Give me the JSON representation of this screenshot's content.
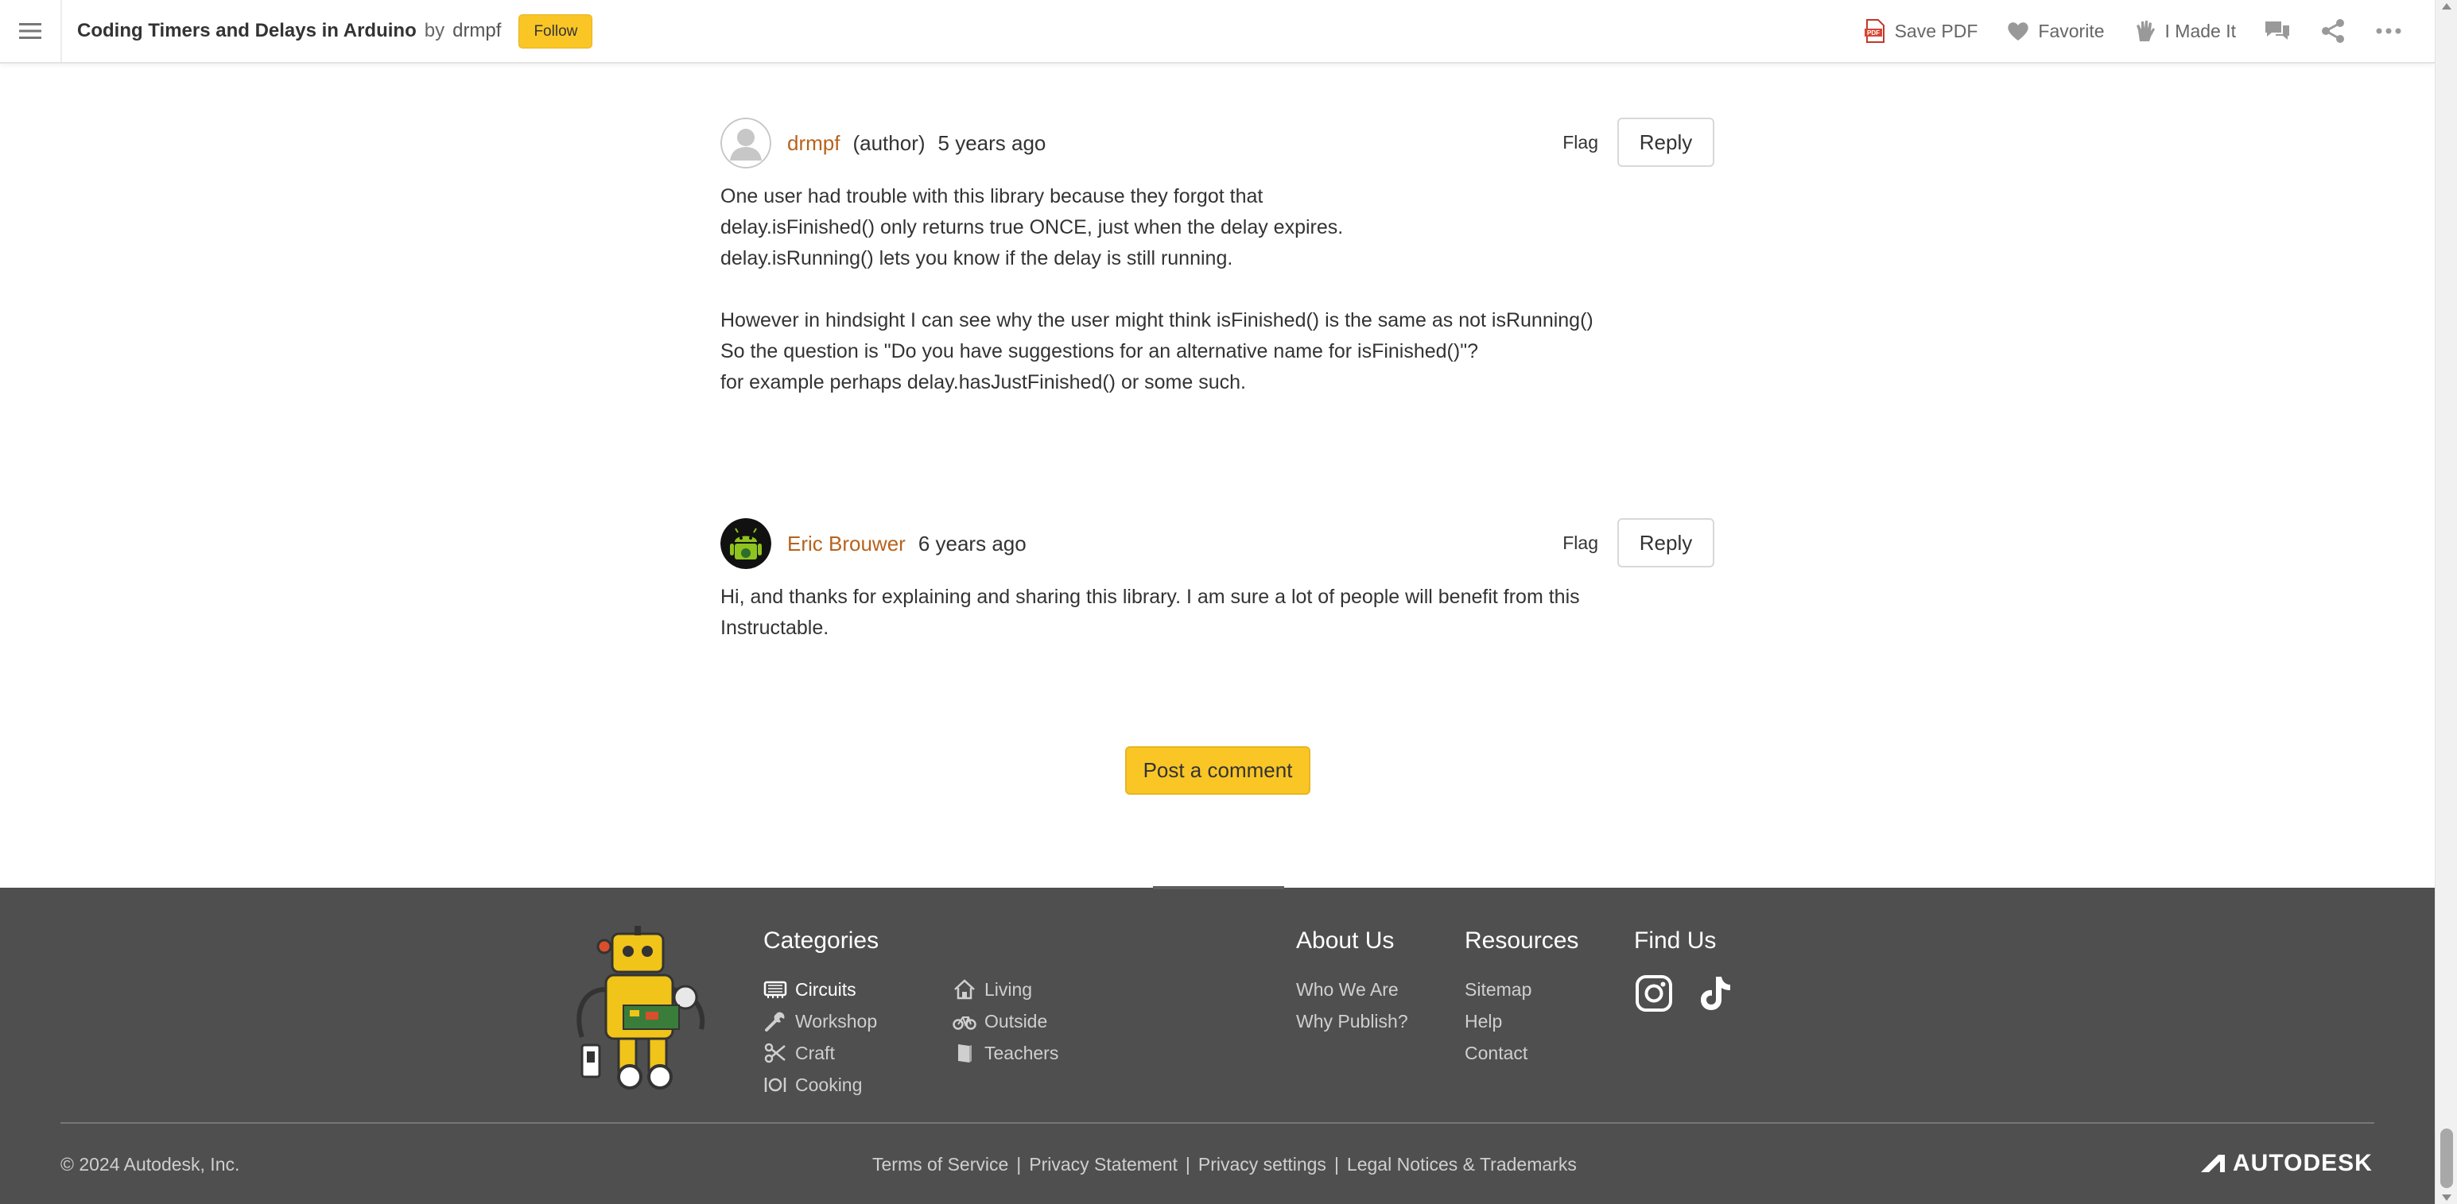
{
  "header": {
    "title": "Coding Timers and Delays in Arduino",
    "by_label": "by",
    "author": "drmpf",
    "follow_label": "Follow",
    "actions": {
      "save_pdf": "Save PDF",
      "favorite": "Favorite",
      "made_it": "I Made It"
    }
  },
  "comments": [
    {
      "author": "drmpf",
      "role": "(author)",
      "time": "5 years ago",
      "flag": "Flag",
      "reply": "Reply",
      "lines": [
        "One user had trouble with this library because they forgot that",
        "delay.isFinished() only returns true ONCE, just when the delay expires.",
        "delay.isRunning() lets you know if the delay is still running.",
        "",
        "However in hindsight I can see why the user might think isFinished() is the same as not isRunning()",
        "So the question is \"Do you have suggestions for an alternative name for isFinished()\"?",
        "for example perhaps delay.hasJustFinished() or some such."
      ]
    },
    {
      "author": "Eric Brouwer",
      "time": "6 years ago",
      "flag": "Flag",
      "reply": "Reply",
      "text": "Hi, and thanks for explaining and sharing this library. I am sure a lot of people will benefit from this Instructable."
    }
  ],
  "post_comment_label": "Post a comment",
  "footer": {
    "categories_heading": "Categories",
    "categories_col1": [
      "Circuits",
      "Workshop",
      "Craft",
      "Cooking"
    ],
    "categories_col2": [
      "Living",
      "Outside",
      "Teachers"
    ],
    "about_heading": "About Us",
    "about_links": [
      "Who We Are",
      "Why Publish?"
    ],
    "resources_heading": "Resources",
    "resources_links": [
      "Sitemap",
      "Help",
      "Contact"
    ],
    "find_heading": "Find Us",
    "copyright": "© 2024 Autodesk, Inc.",
    "legal_links": [
      "Terms of Service",
      "Privacy Statement",
      "Privacy settings",
      "Legal Notices & Trademarks"
    ],
    "brand": "AUTODESK"
  },
  "colors": {
    "accent_yellow": "#fac626",
    "author_link": "#b8621b",
    "footer_bg": "#4f4f4f"
  }
}
